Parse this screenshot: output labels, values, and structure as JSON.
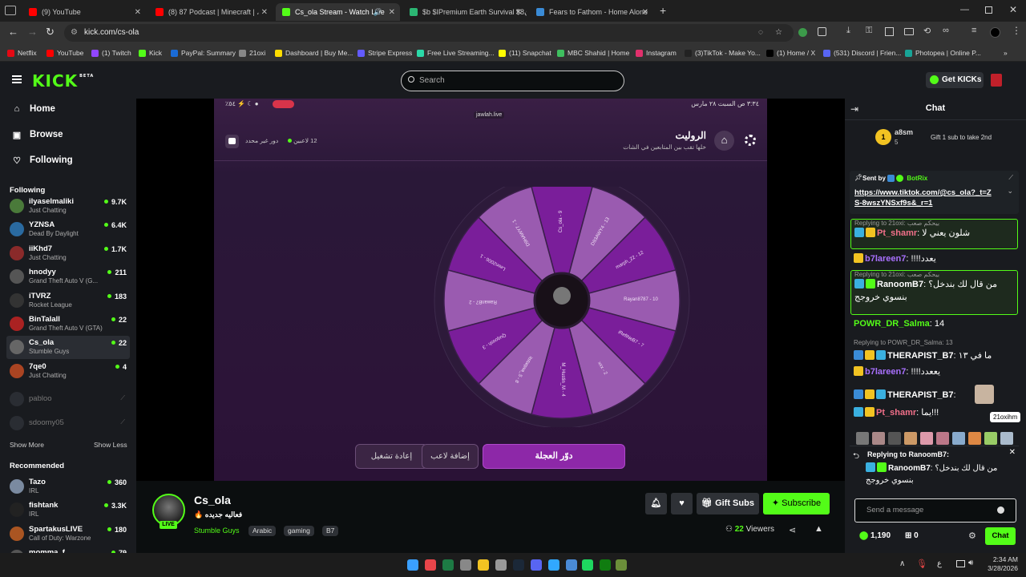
{
  "tabs": [
    {
      "title": "(9) YouTube",
      "color": "#ff0000"
    },
    {
      "title": "(8) 87 Podcast | Minecraft | ،",
      "color": "#ff0000"
    },
    {
      "title": "Cs_ola Stream - Watch Live",
      "color": "#53fc18"
    },
    {
      "title": "$b $ΙPremium Earth Survival $8ن",
      "color": "#2bb673"
    },
    {
      "title": "Fears to Fathom - Home Alone",
      "color": "#3a8bd6"
    }
  ],
  "address": {
    "url": "kick.com/cs-ola"
  },
  "bookmarks": [
    {
      "label": "Netflix",
      "color": "#e50914"
    },
    {
      "label": "YouTube",
      "color": "#ff0000"
    },
    {
      "label": "(1) Twitch",
      "color": "#9146ff"
    },
    {
      "label": "Kick",
      "color": "#53fc18"
    },
    {
      "label": "PayPal: Summary",
      "color": "#1a6bd6"
    },
    {
      "label": "21oxi",
      "color": "#888888"
    },
    {
      "label": "Dashboard | Buy Me...",
      "color": "#ffdd00"
    },
    {
      "label": "Stripe Express",
      "color": "#635bff"
    },
    {
      "label": "Free Live Streaming...",
      "color": "#2bd9a8"
    },
    {
      "label": "(11) Snapchat",
      "color": "#fffc00"
    },
    {
      "label": "MBC Shahid | Home",
      "color": "#3fbf5f"
    },
    {
      "label": "Instagram",
      "color": "#e1306c"
    },
    {
      "label": "(3)TikTok - Make Yo...",
      "color": "#222222"
    },
    {
      "label": "(1) Home / X",
      "color": "#000000"
    },
    {
      "label": "(531) Discord | Frien...",
      "color": "#5865f2"
    },
    {
      "label": "Photopea | Online P...",
      "color": "#18a497"
    }
  ],
  "header": {
    "logo": "KICK",
    "beta": "BETA",
    "search_placeholder": "Search",
    "get_kicks": "Get KICKs"
  },
  "sidebar": {
    "nav": [
      {
        "label": "Home"
      },
      {
        "label": "Browse"
      },
      {
        "label": "Following"
      }
    ],
    "following_title": "Following",
    "following": [
      {
        "name": "ilyaselmaliki",
        "cat": "Just Chatting",
        "viewers": "9.7K",
        "color": "#4a7a3a"
      },
      {
        "name": "YZNSA",
        "cat": "Dead By Daylight",
        "viewers": "6.4K",
        "color": "#2a6aa0"
      },
      {
        "name": "iiKhd7",
        "cat": "Just Chatting",
        "viewers": "1.7K",
        "color": "#8a2a2a"
      },
      {
        "name": "hnodyy",
        "cat": "Grand Theft Auto V (G...",
        "viewers": "211",
        "color": "#555555"
      },
      {
        "name": "iTVRZ",
        "cat": "Rocket League",
        "viewers": "183",
        "color": "#333333"
      },
      {
        "name": "BinTalall",
        "cat": "Grand Theft Auto V (GTA)",
        "viewers": "22",
        "color": "#aa2222"
      },
      {
        "name": "Cs_ola",
        "cat": "Stumble Guys",
        "viewers": "22",
        "color": "#666666"
      },
      {
        "name": "7qe0",
        "cat": "Just Chatting",
        "viewers": "4",
        "color": "#aa4422"
      }
    ],
    "offline": [
      {
        "name": "pabloo"
      },
      {
        "name": "sdoomy05"
      }
    ],
    "show_more": "Show More",
    "show_less": "Show Less",
    "recommended_title": "Recommended",
    "recommended": [
      {
        "name": "Tazo",
        "cat": "IRL",
        "viewers": "360",
        "color": "#7a8aa0"
      },
      {
        "name": "fishtank",
        "cat": "IRL",
        "viewers": "3.3K",
        "color": "#222222"
      },
      {
        "name": "SpartakusLIVE",
        "cat": "Call of Duty: Warzone",
        "viewers": "180",
        "color": "#aa5522"
      },
      {
        "name": "momma_f...",
        "cat": "",
        "viewers": "79",
        "color": "#555555"
      }
    ]
  },
  "player": {
    "status_time": "٣:٣٤ ص  السبت ٢٨ مارس",
    "battery": "٪٥٤",
    "site": "jawlah.live",
    "game_title": "الروليت",
    "game_sub": "خلها تقب بين المتابعين في الشات",
    "players": "12 لاعبين",
    "round": "دور غير محدد",
    "segments": [
      "Cs_ola - 9",
      "D93AWY4 - 13",
      "marph_22 - 12",
      "Rayan8787 - 10",
      "iRefiNeB7 - 7",
      "xxx - 2",
      "M_Hustin_M - 4",
      "itstaqwa_5 - 8",
      "Quqoosh - 3",
      "RawanB7 - 2",
      "Leen2006 - 1",
      "D9HAWY7 - 1"
    ],
    "btn_reset": "إعادة تشغيل",
    "btn_add": "إضافة لاعب",
    "btn_spin": "دوّر العجلة"
  },
  "stream_info": {
    "channel": "Cs_ola",
    "live": "LIVE",
    "title": "فعاليه جديده",
    "category": "Stumble Guys",
    "tags": [
      "Arabic",
      "gaming",
      "B7"
    ],
    "viewers": "22",
    "viewers_label": "Viewers",
    "gift_subs": "Gift Subs",
    "subscribe": "Subscribe"
  },
  "chat": {
    "title": "Chat",
    "top_gifter": "a8sm",
    "top_gifter_count": "5",
    "gift_note": "Gift 1 sub to take 2nd",
    "pinned_by": "Sent by",
    "pinned_bot": "BotRix",
    "pinned_link": "https://www.tiktok.com/@cs_ola?_t=ZS-8wszYNSxf9s&_r=1",
    "messages": [
      {
        "reply": "Replying to 21oxi: بيحكم صعب",
        "user": "Pt_shamr",
        "ucolor": "#f2708a",
        "text": "شلون يعني لا",
        "boxed": true
      },
      {
        "reply": "",
        "user": "b7lareen7",
        "ucolor": "#a970ff",
        "text": "!!!!يعدد",
        "boxed": false
      },
      {
        "reply": "Replying to 21oxi: بيحكم صعب",
        "user": "RanoomB7",
        "ucolor": "#ffffff",
        "text": "من قال لك بندخل؟ بنسوي خروجج",
        "boxed": true
      },
      {
        "reply": "",
        "user": "POWR_DR_Salma",
        "ucolor": "#53fc18",
        "text": "14",
        "boxed": false
      },
      {
        "reply": "Replying to POWR_DR_Salma: 13",
        "user": "THERAPIST_B7",
        "ucolor": "#ffffff",
        "text": "ما في ١٣",
        "boxed": false
      },
      {
        "reply": "",
        "user": "b7lareen7",
        "ucolor": "#a970ff",
        "text": "!!!!يععدد",
        "boxed": false
      },
      {
        "reply": "",
        "user": "THERAPIST_B7",
        "ucolor": "#ffffff",
        "text": "",
        "boxed": false
      },
      {
        "reply": "",
        "user": "Pt_shamr",
        "ucolor": "#f2708a",
        "text": "يما!!!",
        "boxed": false
      }
    ],
    "tooltip": "21oxihm",
    "replying_to": "Replying to RanoomB7:",
    "reply_user": "RanoomB7",
    "reply_text": "من قال لك بندخل؟ بنسوي خروجج",
    "input_placeholder": "Send a message",
    "points": "1,190",
    "kicks": "0",
    "send": "Chat"
  },
  "taskbar": {
    "time": "2:34 AM",
    "date": "3/28/2026",
    "lang": "ع"
  }
}
